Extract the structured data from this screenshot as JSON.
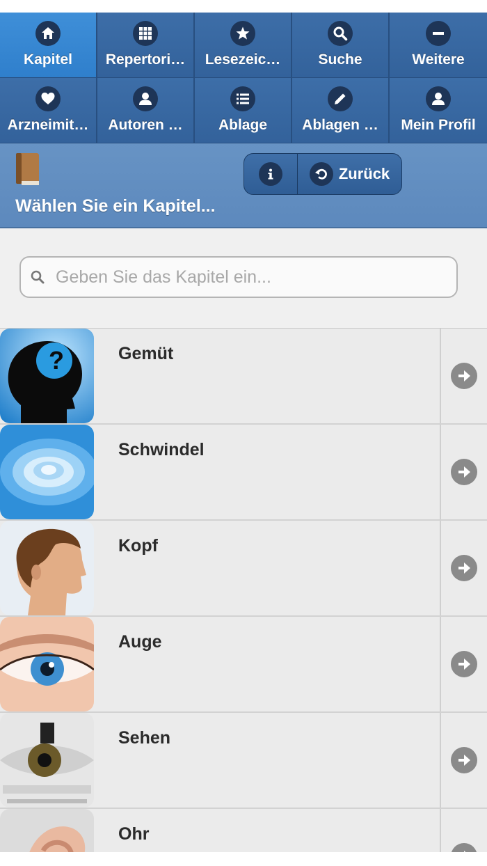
{
  "nav": {
    "items": [
      {
        "label": "Kapitel",
        "icon": "home-icon"
      },
      {
        "label": "Repertori…",
        "icon": "grid-icon"
      },
      {
        "label": "Lesezeic…",
        "icon": "star-icon"
      },
      {
        "label": "Suche",
        "icon": "search-icon"
      },
      {
        "label": "Weitere",
        "icon": "minus-icon"
      },
      {
        "label": "Arzneimit…",
        "icon": "heart-icon"
      },
      {
        "label": "Autoren …",
        "icon": "user-icon"
      },
      {
        "label": "Ablage",
        "icon": "list-icon"
      },
      {
        "label": "Ablagen …",
        "icon": "pencil-icon"
      },
      {
        "label": "Mein Profil",
        "icon": "user-icon"
      }
    ]
  },
  "header": {
    "title": "Wählen Sie ein Kapitel...",
    "back_label": "Zurück"
  },
  "search": {
    "placeholder": "Geben Sie das Kapitel ein..."
  },
  "chapters": [
    {
      "label": "Gemüt",
      "image": "head-silhouette-question"
    },
    {
      "label": "Schwindel",
      "image": "blue-spiral"
    },
    {
      "label": "Kopf",
      "image": "head-profile"
    },
    {
      "label": "Auge",
      "image": "blue-eye"
    },
    {
      "label": "Sehen",
      "image": "eye-chart"
    },
    {
      "label": "Ohr",
      "image": "ear"
    }
  ],
  "colors": {
    "nav_bg": "#33629b",
    "nav_active": "#2f7fcc",
    "header_bg": "#5d89bd",
    "list_bg": "#ebebeb"
  }
}
